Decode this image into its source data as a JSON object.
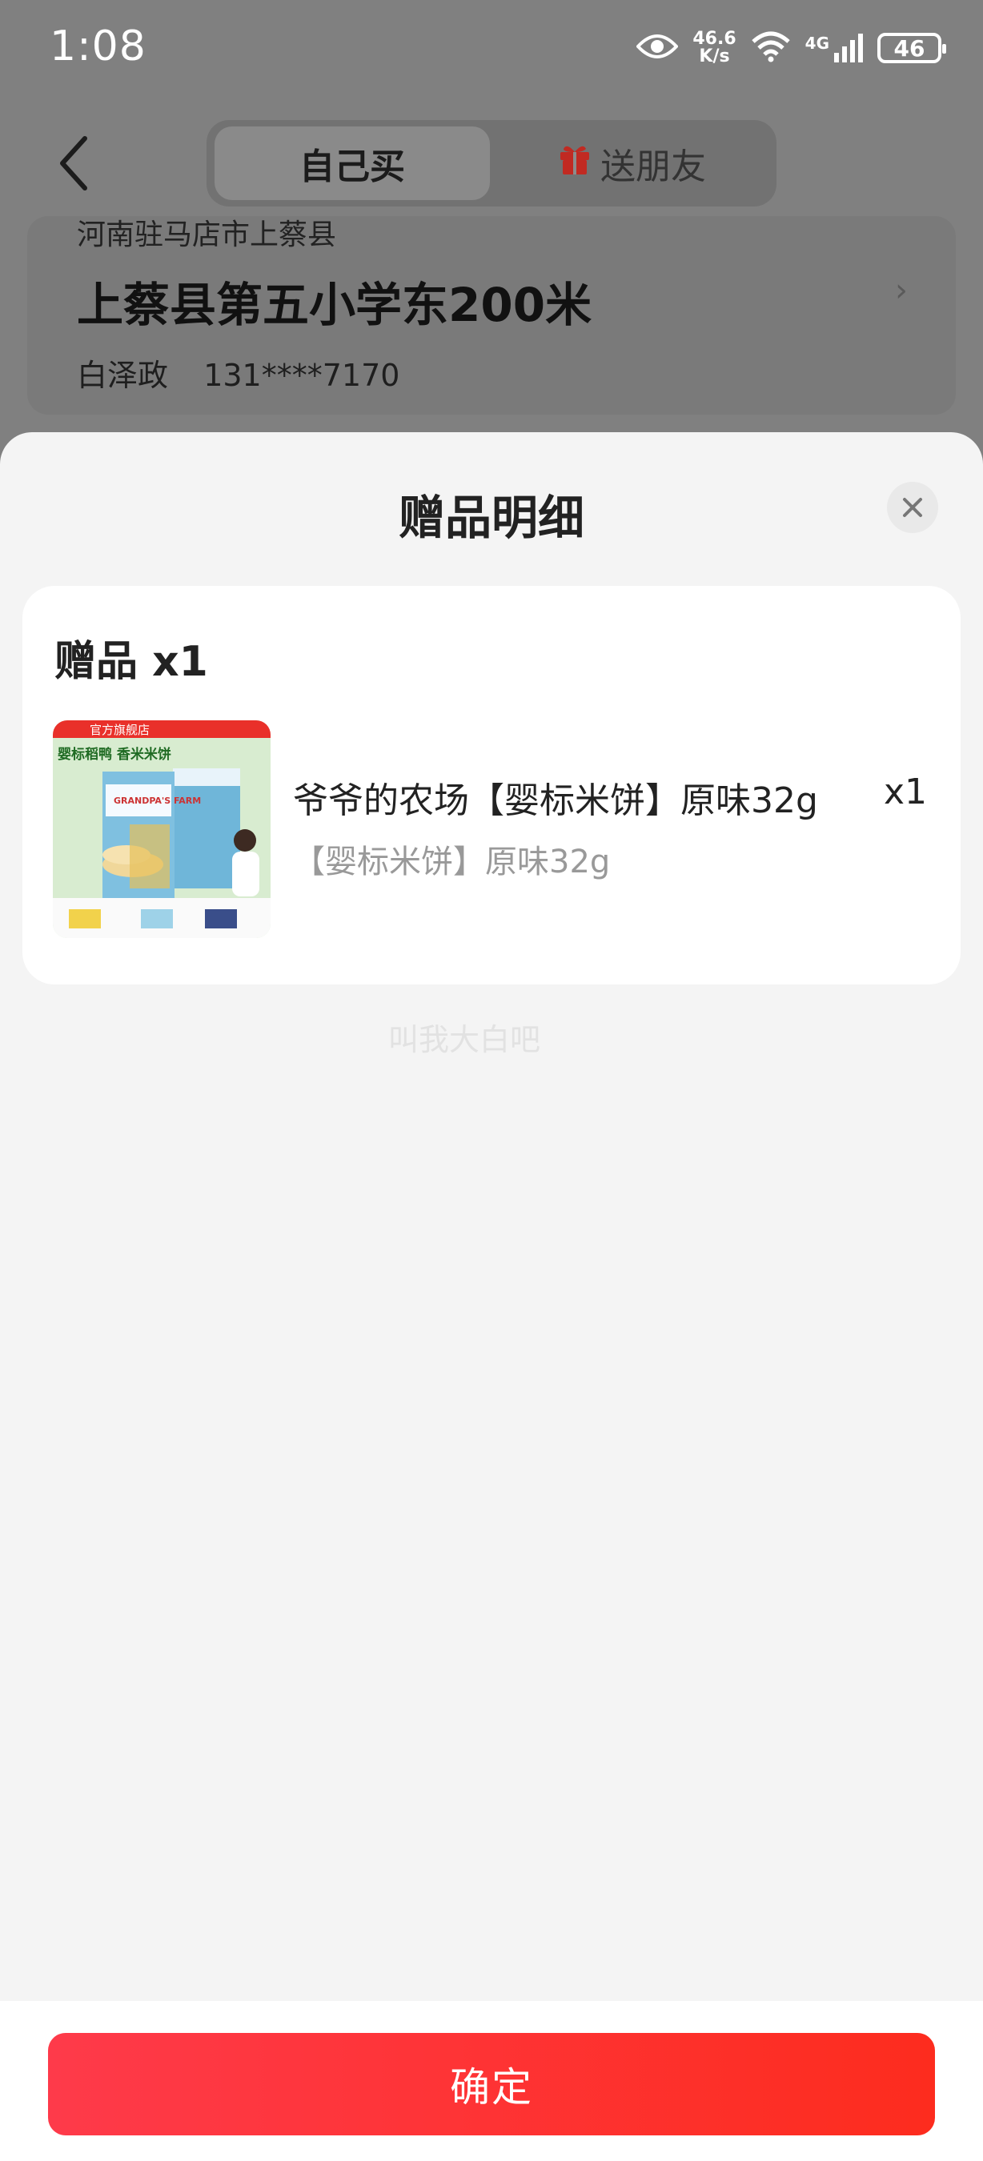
{
  "status_bar": {
    "time": "1:08",
    "net_speed_value": "46.6",
    "net_speed_unit": "K/s",
    "network": "4G",
    "battery": "46"
  },
  "header": {
    "tab_self": "自己买",
    "tab_gift": "送朋友"
  },
  "address": {
    "region": "河南驻马店市上蔡县",
    "detail": "上蔡县第五小学东200米",
    "name": "白泽政",
    "phone": "131****7170"
  },
  "sheet": {
    "title": "赠品明细",
    "gift_heading": "赠品 x1",
    "item": {
      "name": "爷爷的农场【婴标米饼】原味32g",
      "qty": "x1",
      "spec": "【婴标米饼】原味32g",
      "thumb_badge": "官方旗舰店",
      "thumb_caption": "婴标稻鸭 香米米饼",
      "thumb_brand": "GRANDPA'S FARM"
    },
    "watermark": "叫我大白吧"
  },
  "footer": {
    "confirm_label": "确定"
  },
  "colors": {
    "accent": "#fe3426",
    "gift_icon": "#e8362c"
  }
}
